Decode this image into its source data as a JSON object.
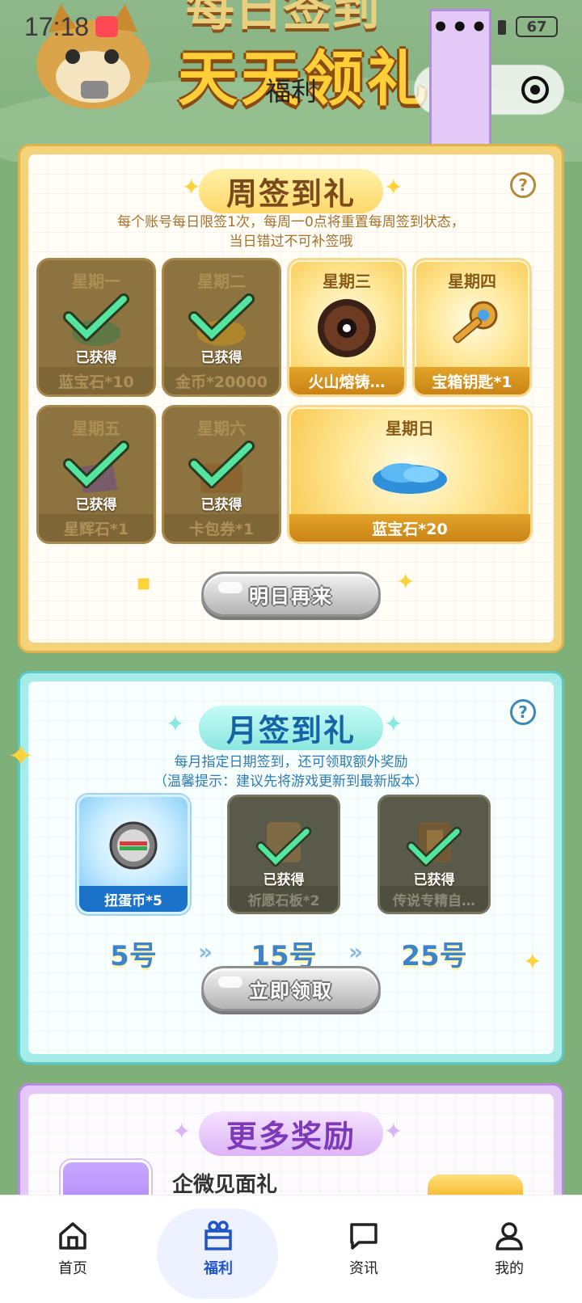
{
  "status_bar": {
    "time": "17:18",
    "battery": "67"
  },
  "header": {
    "banner_title": "天天领礼包",
    "banner_top": "每日签到",
    "nav_title": "福利"
  },
  "weekly": {
    "title": "周签到礼",
    "desc_line1": "每个账号每日限签1次，每周一0点将重置每周签到状态，",
    "desc_line2": "当日错过不可补签哦",
    "got_label": "已获得",
    "days": [
      {
        "day": "星期一",
        "reward": "蓝宝石*10",
        "claimed": true,
        "icon": "sapphire-icon"
      },
      {
        "day": "星期二",
        "reward": "金币*20000",
        "claimed": true,
        "icon": "gold-coins-icon"
      },
      {
        "day": "星期三",
        "reward": "火山熔铸…",
        "claimed": false,
        "icon": "volcano-ring-icon"
      },
      {
        "day": "星期四",
        "reward": "宝箱钥匙*1",
        "claimed": false,
        "icon": "key-icon"
      },
      {
        "day": "星期五",
        "reward": "星辉石*1",
        "claimed": true,
        "icon": "star-stone-icon"
      },
      {
        "day": "星期六",
        "reward": "卡包券*1",
        "claimed": true,
        "icon": "card-pack-icon"
      },
      {
        "day": "星期日",
        "reward": "蓝宝石*20",
        "claimed": false,
        "icon": "sapphire-pile-icon"
      }
    ],
    "button_label": "明日再来"
  },
  "monthly": {
    "title": "月签到礼",
    "desc_line1": "每月指定日期签到，还可领取额外奖励",
    "desc_line2": "（温馨提示：建议先将游戏更新到最新版本）",
    "got_label": "已获得",
    "rewards": [
      {
        "reward": "扭蛋币*5",
        "date": "5号",
        "claimed": false,
        "icon": "gacha-coin-icon"
      },
      {
        "reward": "祈愿石板*2",
        "date": "15号",
        "claimed": true,
        "icon": "wish-tablet-icon"
      },
      {
        "reward": "传说专精自…",
        "date": "25号",
        "claimed": true,
        "icon": "legend-book-icon"
      }
    ],
    "button_label": "立即领取"
  },
  "more": {
    "title": "更多奖励",
    "item_title": "企微见面礼"
  },
  "tabbar": {
    "items": [
      {
        "label": "首页",
        "icon": "home-icon",
        "active": false
      },
      {
        "label": "福利",
        "icon": "gift-icon",
        "active": true
      },
      {
        "label": "资讯",
        "icon": "message-icon",
        "active": false
      },
      {
        "label": "我的",
        "icon": "user-icon",
        "active": false
      }
    ]
  },
  "colors": {
    "accent_blue": "#1e55c8",
    "weekly_border": "#e0b24c",
    "monthly_border": "#5cc8c4",
    "more_border": "#b58ae0"
  }
}
